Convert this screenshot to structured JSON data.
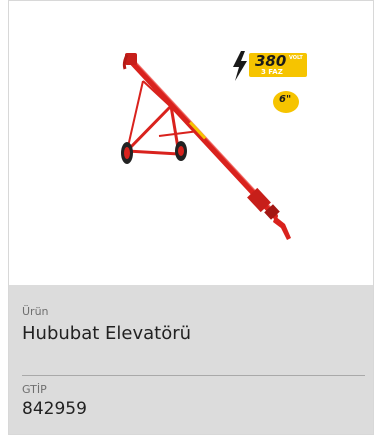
{
  "product": {
    "urun_label": "Ürün",
    "urun_value": "Hububat Elevatörü",
    "gtip_label": "GTİP",
    "gtip_value": "842959"
  },
  "badges": {
    "voltage": "380",
    "volt_unit": "VOLT",
    "phase": "3 FAZ",
    "size": "6\""
  },
  "icons": [
    "lightning-icon"
  ],
  "colors": {
    "machine_red": "#d9221d",
    "badge_yellow": "#f6c400",
    "info_bg": "#dcdcdc"
  }
}
